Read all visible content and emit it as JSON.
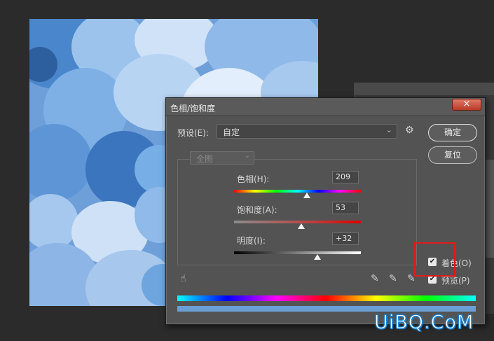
{
  "dialog": {
    "title": "色相/饱和度",
    "close_symbol": "×",
    "preset_label": "预设(E):",
    "preset_value": "自定",
    "ok_label": "确定",
    "reset_label": "复位",
    "channel_value": "全图",
    "sliders": [
      {
        "label": "色相(H):",
        "value": "209",
        "position": 0.577
      },
      {
        "label": "饱和度(A):",
        "value": "53",
        "position": 0.53
      },
      {
        "label": "明度(I):",
        "value": "+32",
        "position": 0.66
      }
    ],
    "colorize_label": "着色(O)",
    "preview_label": "预览(P)",
    "check_mark": "✔"
  },
  "icons": {
    "close": "close-icon",
    "chevron": "chevron-down-icon",
    "gear": "gear-icon",
    "hand": "hand-icon",
    "eyedropper": "eyedropper-icon"
  },
  "colors": {
    "accent_highlight": "#e01b1b",
    "colorize_tint": "#6a9fd6"
  },
  "watermark": "UiBQ.CoM"
}
